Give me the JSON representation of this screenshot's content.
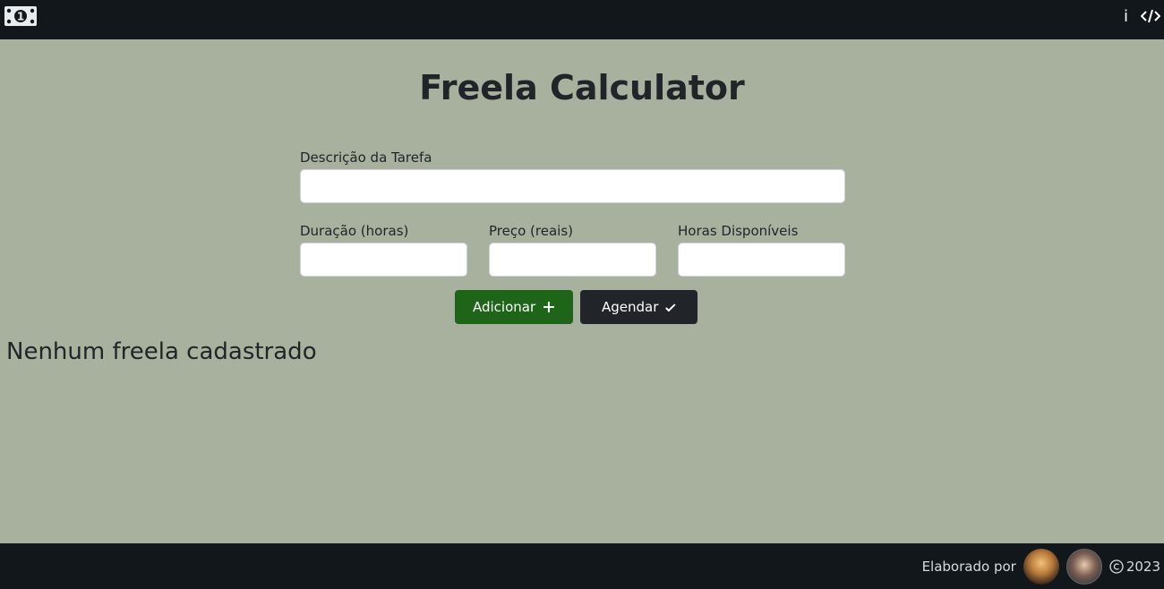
{
  "header": {
    "logo_icon": "money-bill-icon",
    "info_icon": "info-icon",
    "code_icon": "code-icon",
    "info_glyph": "i"
  },
  "main": {
    "title": "Freela Calculator",
    "description_label": "Descrição da Tarefa",
    "description_value": "",
    "duration_label": "Duração (horas)",
    "duration_value": "",
    "price_label": "Preço (reais)",
    "price_value": "",
    "hours_label": "Horas Disponíveis",
    "hours_value": "",
    "add_button": "Adicionar",
    "schedule_button": "Agendar",
    "empty_message": "Nenhum freela cadastrado"
  },
  "footer": {
    "text": "Elaborado por",
    "copyright": "2023"
  },
  "colors": {
    "background": "#a8b19e",
    "bar": "#12171c",
    "add_button": "#1e6419",
    "schedule_button": "#212529"
  }
}
